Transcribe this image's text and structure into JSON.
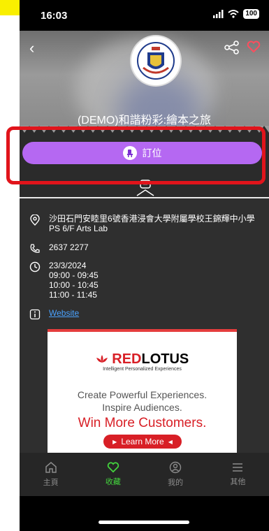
{
  "status_bar": {
    "time": "16:03",
    "battery": "100"
  },
  "event": {
    "title": "(DEMO)和諧粉彩:繪本之旅",
    "book_button_label": "訂位",
    "address": "沙田石門安睦里6號香港浸會大學附屬學校王錦輝中小學 PS 6/F Arts Lab",
    "phone": "2637 2277",
    "date": "23/3/2024",
    "time_slots": [
      "09:00 - 09:45",
      "10:00 - 10:45",
      "11:00 - 11:45"
    ],
    "website_label": "Website"
  },
  "ad": {
    "brand_prefix": "RED",
    "brand_suffix": "LOTUS",
    "tagline": "Intelligent Personalized Experiences",
    "line1": "Create Powerful Experiences.",
    "line2": "Inspire Audiences.",
    "line3": "Win More Customers.",
    "cta": "Learn More"
  },
  "tabs": [
    {
      "label": "主頁",
      "icon": "home-icon"
    },
    {
      "label": "收藏",
      "icon": "heart-icon",
      "active": true
    },
    {
      "label": "我的",
      "icon": "profile-icon"
    },
    {
      "label": "其他",
      "icon": "menu-icon"
    }
  ],
  "colors": {
    "accent_purple": "#b568f2",
    "tab_active": "#43d43d",
    "highlight_red": "#e1141b",
    "ad_red": "#d81f26"
  }
}
